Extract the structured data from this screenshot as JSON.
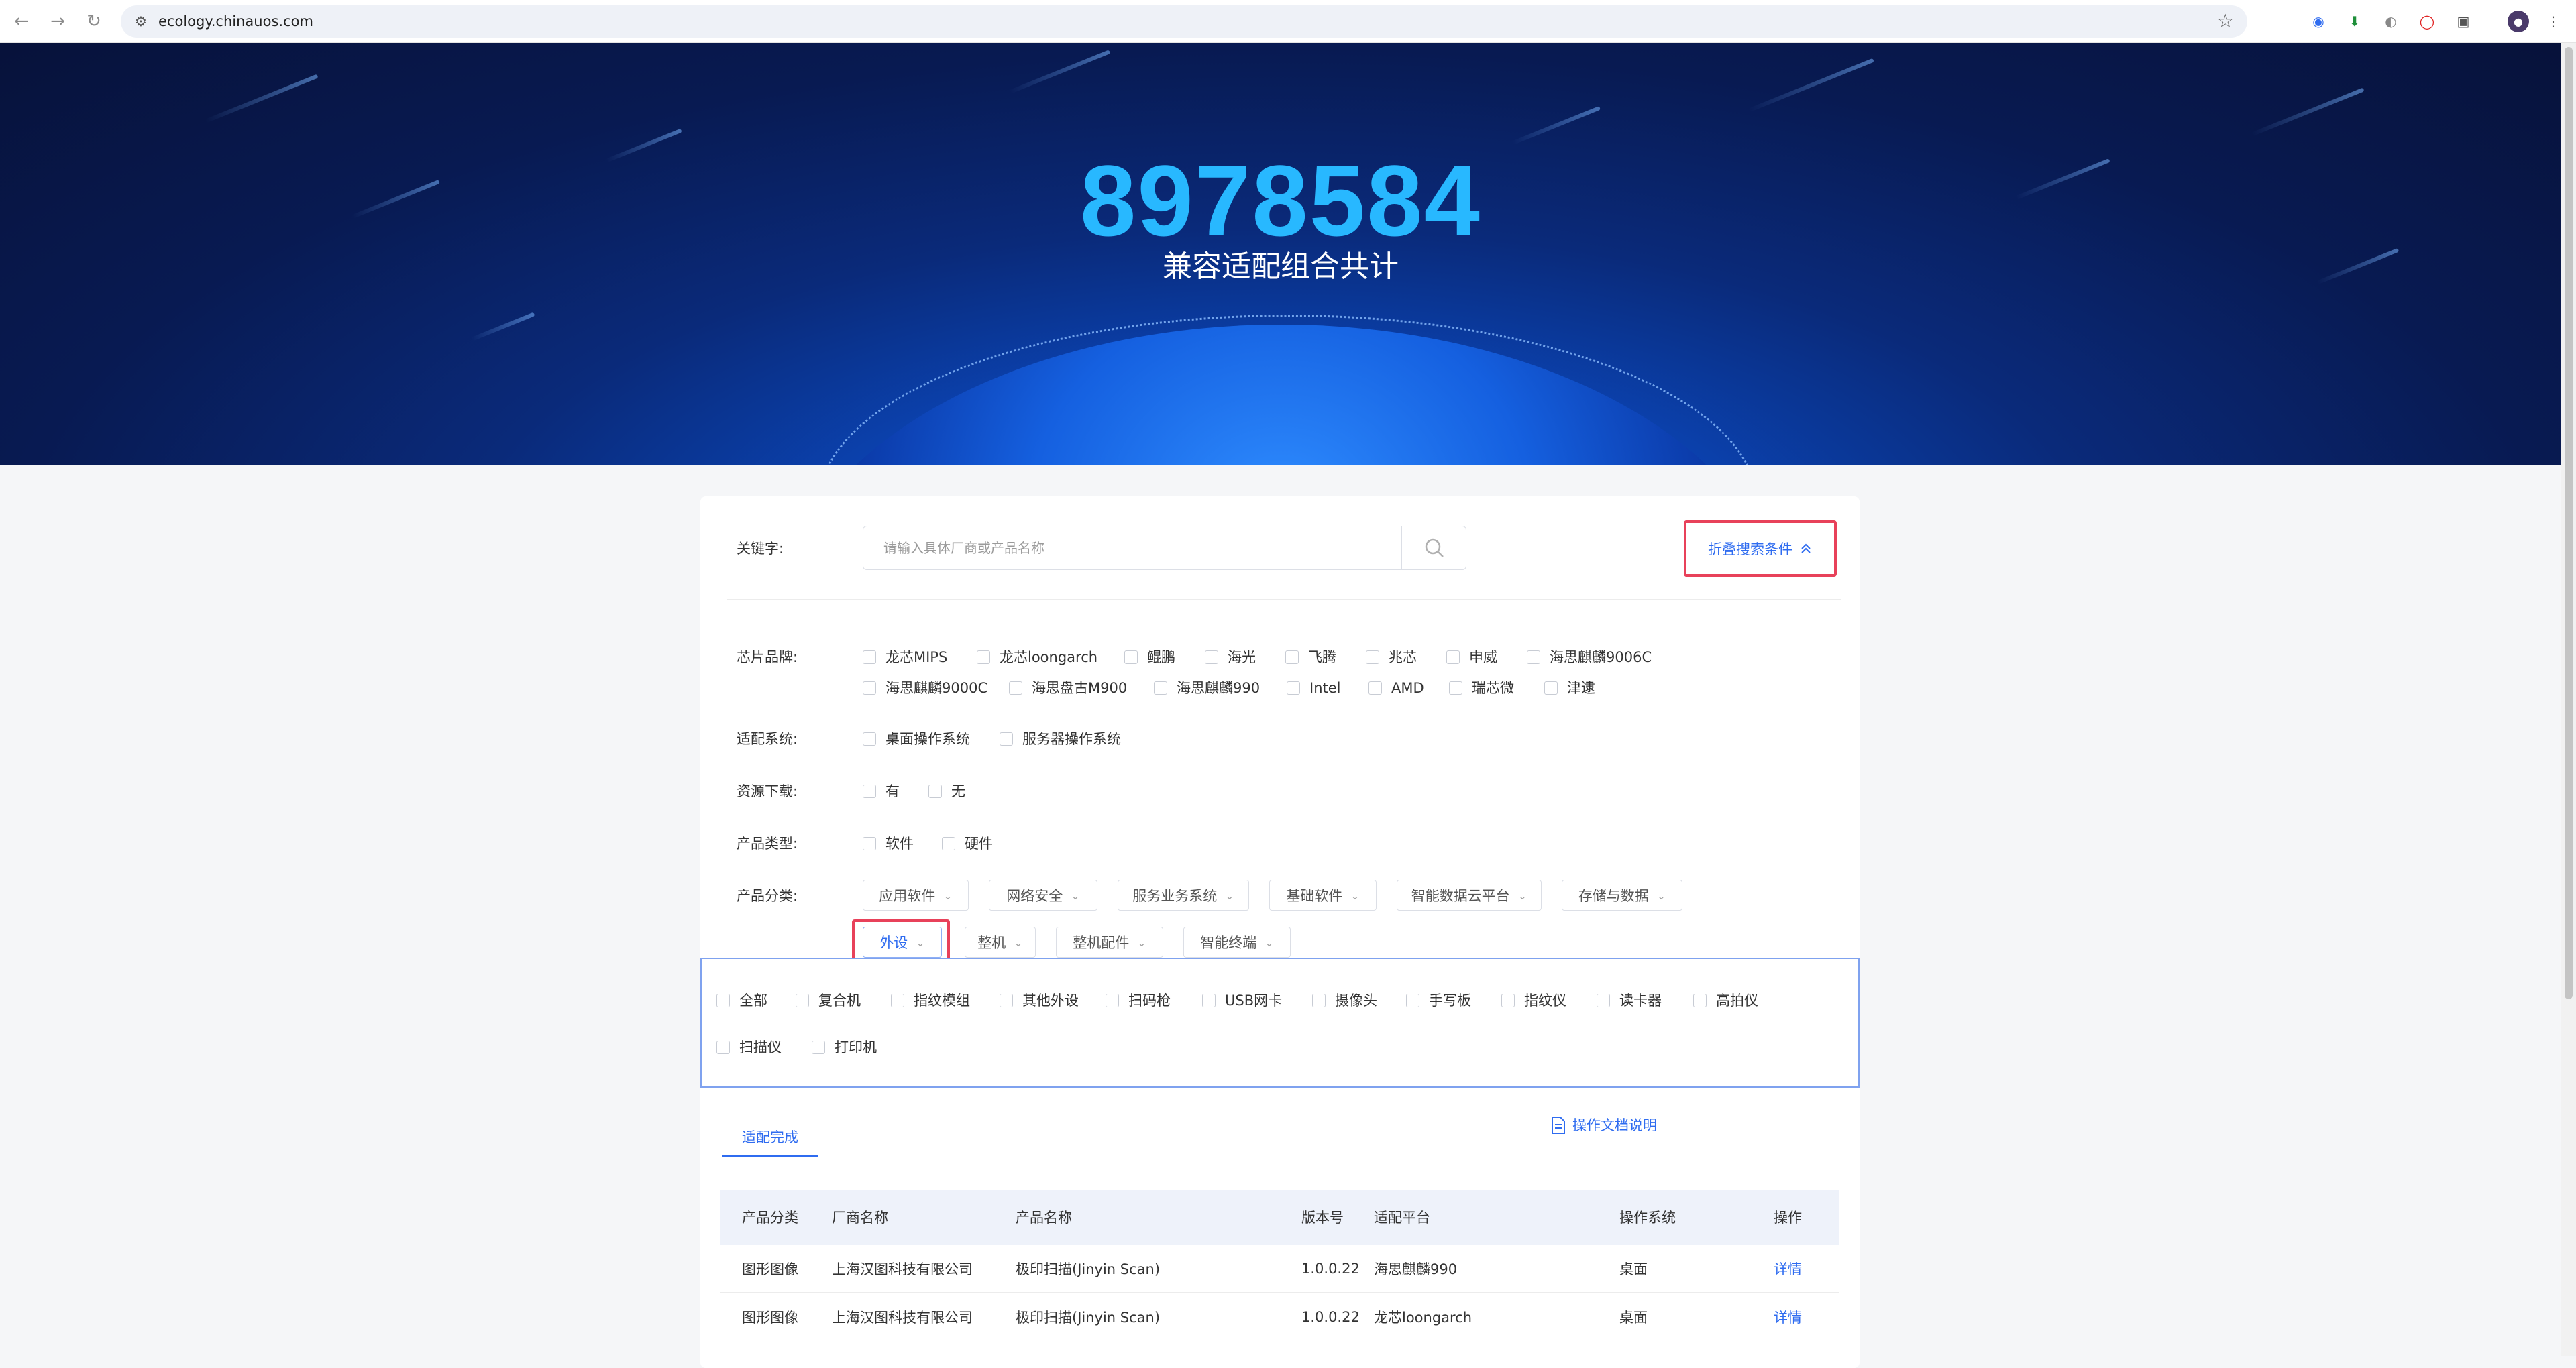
{
  "browser": {
    "url": "ecology.chinauos.com"
  },
  "hero": {
    "total": "8978584",
    "subtitle": "兼容适配组合共计"
  },
  "search": {
    "keyword_label": "关键字:",
    "placeholder": "请输入具体厂商或产品名称",
    "collapse_label": "折叠搜索条件"
  },
  "filters": {
    "chip_brand": {
      "label": "芯片品牌:",
      "options": [
        "龙芯MIPS",
        "龙芯loongarch",
        "鲲鹏",
        "海光",
        "飞腾",
        "兆芯",
        "申威",
        "海思麒麟9006C",
        "海思麒麟9000C",
        "海思盘古M900",
        "海思麒麟990",
        "Intel",
        "AMD",
        "瑞芯微",
        "津逮"
      ]
    },
    "system": {
      "label": "适配系统:",
      "options": [
        "桌面操作系统",
        "服务器操作系统"
      ]
    },
    "download": {
      "label": "资源下载:",
      "options": [
        "有",
        "无"
      ]
    },
    "product_type": {
      "label": "产品类型:",
      "options": [
        "软件",
        "硬件"
      ]
    },
    "category": {
      "label": "产品分类:",
      "dropdowns": [
        "应用软件",
        "网络安全",
        "服务业务系统",
        "基础软件",
        "智能数据云平台",
        "存储与数据",
        "外设",
        "整机",
        "整机配件",
        "智能终端"
      ],
      "active": "外设"
    },
    "peripheral_options": [
      "全部",
      "复合机",
      "指纹模组",
      "其他外设",
      "扫码枪",
      "USB网卡",
      "摄像头",
      "手写板",
      "指纹仪",
      "读卡器",
      "高拍仪",
      "扫描仪",
      "打印机"
    ]
  },
  "results": {
    "tab": "适配完成",
    "doc_link": "操作文档说明",
    "columns": [
      "产品分类",
      "厂商名称",
      "产品名称",
      "版本号",
      "适配平台",
      "操作系统",
      "操作"
    ],
    "rows": [
      [
        "图形图像",
        "上海汉图科技有限公司",
        "极印扫描(Jinyin Scan)",
        "1.0.0.22",
        "海思麒麟990",
        "桌面",
        "详情"
      ],
      [
        "图形图像",
        "上海汉图科技有限公司",
        "极印扫描(Jinyin Scan)",
        "1.0.0.22",
        "龙芯loongarch",
        "桌面",
        "详情"
      ]
    ]
  },
  "colors": {
    "accent": "#2f6cf0",
    "highlight": "#e8415a",
    "hero_number": "#28b8ff"
  }
}
